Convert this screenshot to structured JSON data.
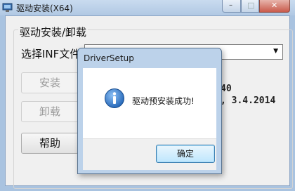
{
  "window": {
    "title": "驱动安装(X64)",
    "caption_buttons": {
      "minimize": "–",
      "maximize": "□",
      "close": "✕"
    }
  },
  "group": {
    "label": "驱动安装/卸载"
  },
  "inf": {
    "label": "选择INF文件",
    "selected": ""
  },
  "buttons": {
    "install": "安装",
    "uninstall": "卸载",
    "help": "帮助"
  },
  "info": {
    "line1": "40",
    "line2": ", 3.4.2014"
  },
  "dialog": {
    "title": "DriverSetup",
    "message": "驱动预安装成功!",
    "ok": "确定",
    "icon": "info-icon"
  },
  "colors": {
    "accent": "#3c7fb1",
    "info_icon": "#1f62b5"
  }
}
